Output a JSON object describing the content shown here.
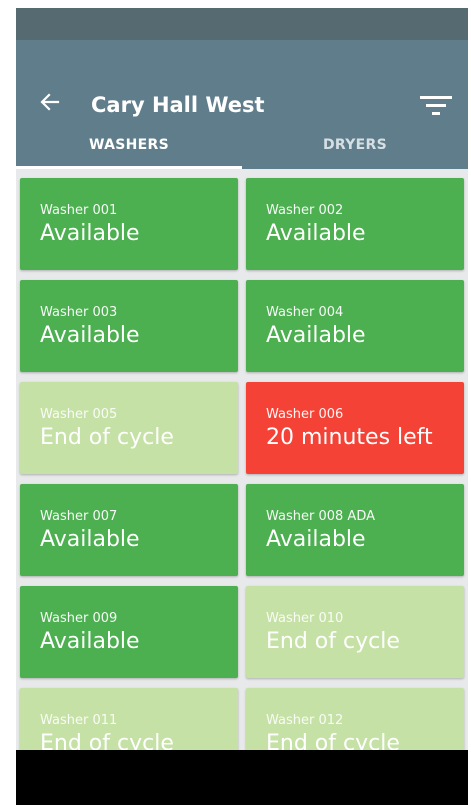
{
  "app_bar": {
    "title": "Cary Hall West",
    "back_icon": "arrow-left-icon",
    "filter_icon": "filter-list-icon"
  },
  "tabs": [
    {
      "label": "WASHERS",
      "active": true
    },
    {
      "label": "DRYERS",
      "active": false
    }
  ],
  "colors": {
    "status_bar": "#566a71",
    "app_bar": "#607d8b",
    "available": "#4caf50",
    "end_of_cycle": "#c5e1a5",
    "in_use": "#f44336",
    "background": "#e7e9ea"
  },
  "machines": [
    {
      "name": "Washer 001",
      "status": "Available",
      "state": "available"
    },
    {
      "name": "Washer 002",
      "status": "Available",
      "state": "available"
    },
    {
      "name": "Washer 003",
      "status": "Available",
      "state": "available"
    },
    {
      "name": "Washer 004",
      "status": "Available",
      "state": "available"
    },
    {
      "name": "Washer 005",
      "status": "End of cycle",
      "state": "end_of_cycle"
    },
    {
      "name": "Washer 006",
      "status": "20 minutes left",
      "state": "in_use"
    },
    {
      "name": "Washer 007",
      "status": "Available",
      "state": "available"
    },
    {
      "name": "Washer 008 ADA",
      "status": "Available",
      "state": "available"
    },
    {
      "name": "Washer 009",
      "status": "Available",
      "state": "available"
    },
    {
      "name": "Washer 010",
      "status": "End of cycle",
      "state": "end_of_cycle"
    },
    {
      "name": "Washer 011",
      "status": "End of cycle",
      "state": "end_of_cycle"
    },
    {
      "name": "Washer 012",
      "status": "End of cycle",
      "state": "end_of_cycle"
    }
  ]
}
